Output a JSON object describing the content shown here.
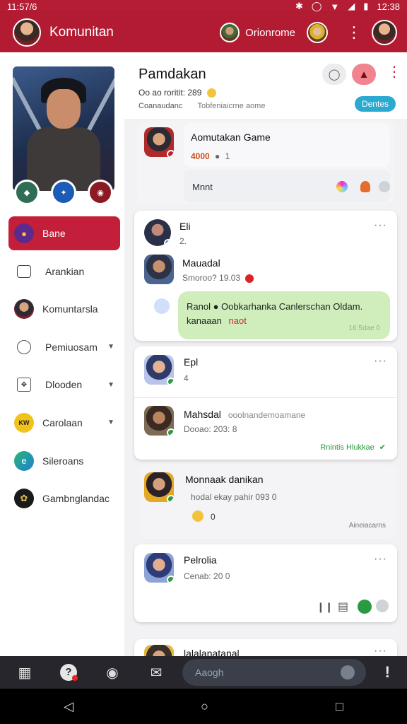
{
  "status_bar": {
    "time": "11:57/6",
    "clock": "12:38"
  },
  "app_bar": {
    "title": "Komunitan",
    "online_label": "Orionrome"
  },
  "sidebar": {
    "menu": [
      {
        "label": "Bane",
        "icon": "mask-icon",
        "active": true,
        "has_caret": false
      },
      {
        "label": "Arankian",
        "icon": "chat-icon",
        "active": false,
        "has_caret": false
      },
      {
        "label": "Komuntarsla",
        "icon": "hero-avatar-icon",
        "active": false,
        "has_caret": false
      },
      {
        "label": "Pemiuosam",
        "icon": "search-user-icon",
        "active": false,
        "has_caret": true
      },
      {
        "label": "Dlooden",
        "icon": "puzzle-icon",
        "active": false,
        "has_caret": true
      },
      {
        "label": "Carolaan",
        "icon": "kw-badge-icon",
        "active": false,
        "has_caret": true
      },
      {
        "label": "Sileroans",
        "icon": "edge-icon",
        "active": false,
        "has_caret": false
      },
      {
        "label": "Gambnglandac",
        "icon": "emblem-icon",
        "active": false,
        "has_caret": false
      }
    ]
  },
  "header": {
    "title": "Pamdakan",
    "line1": "Oo ao roritit: 289",
    "line2_left": "Coanaudanc",
    "line2_right": "Tobfeniaicrne aome",
    "filter_label": "Dentes"
  },
  "feed": {
    "game_card": {
      "title": "Aomutakan Game",
      "score": "4000",
      "count": "1",
      "sub_label": "Mnnt"
    },
    "post_eli": {
      "name": "Eli",
      "meta": "2."
    },
    "msg_mauadal": {
      "name": "Mauadal",
      "meta": "Smoroo? 19.03"
    },
    "bubble": {
      "line1": "Ranol ● Oobkarhanka Canlerschan Oldam.",
      "line2a": "kanaaan",
      "line2b": "naot",
      "time": "16:5dae 0"
    },
    "post_epl": {
      "name": "Epl",
      "meta": "4"
    },
    "post_mahsdal": {
      "name": "Mahsdal",
      "name_extra": "ooolnandemoamane",
      "meta": "Dooao: 203: 8",
      "status": "Rnintis Hlukkae"
    },
    "post_monnak": {
      "name": "Monnaak danikan",
      "meta": "hodal ekay pahir 093 0",
      "reactions": "0",
      "time": "Aineiacarns"
    },
    "post_pelrolia": {
      "name": "Pelrolia",
      "meta": "Cenab: 20 0"
    },
    "post_partial": {
      "name": "lalalanatanal"
    }
  },
  "bottom_nav": {
    "search_placeholder": "Aaogh"
  },
  "colors": {
    "brand": "#b31b33",
    "accent": "#2ba9cf",
    "bubble": "#cfeebb"
  }
}
